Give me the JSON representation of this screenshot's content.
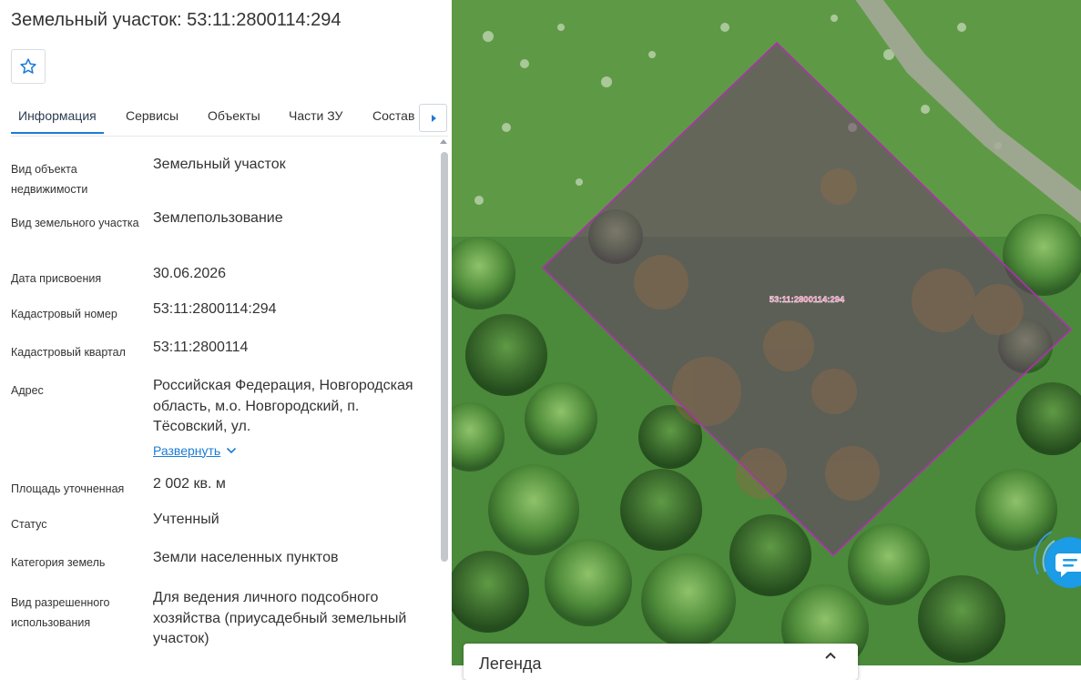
{
  "panel": {
    "title": "Земельный участок: 53:11:2800114:294",
    "favorite_icon": "star-outline-icon",
    "tabs": [
      {
        "label": "Информация",
        "active": true
      },
      {
        "label": "Сервисы"
      },
      {
        "label": "Объекты"
      },
      {
        "label": "Части ЗУ"
      },
      {
        "label": "Состав"
      }
    ],
    "tabs_next_icon": "triangle-right-icon",
    "fields": [
      {
        "label": "Вид объекта недвижимости",
        "value": "Земельный участок"
      },
      {
        "label": "Вид земельного участка",
        "value": "Землепользование"
      },
      {
        "label": "Дата присвоения",
        "value": "30.06.2026"
      },
      {
        "label": "Кадастровый номер",
        "value": "53:11:2800114:294"
      },
      {
        "label": "Кадастровый квартал",
        "value": "53:11:2800114"
      },
      {
        "label": "Адрес",
        "value": "Российская Федерация, Новгородская область, м.о. Новгородский, п. Тёсовский, ул.",
        "expand_label": "Развернуть"
      },
      {
        "label": "Площадь уточненная",
        "value": "2 002 кв. м"
      },
      {
        "label": "Статус",
        "value": "Учтенный"
      },
      {
        "label": "Категория земель",
        "value": "Земли населенных пунктов"
      },
      {
        "label": "Вид разрешенного использования",
        "value": "Для ведения личного подсобного хозяйства (приусадебный земельный участок)"
      }
    ]
  },
  "map": {
    "parcel_label": "53:11:2800114:294",
    "parcel_outline_color": "#b030b0",
    "legend_title": "Легенда",
    "legend_icon": "chevron-up-icon",
    "chat_icon": "chat-bubble-icon"
  },
  "colors": {
    "accent": "#1c7cd5",
    "text": "#333333"
  }
}
